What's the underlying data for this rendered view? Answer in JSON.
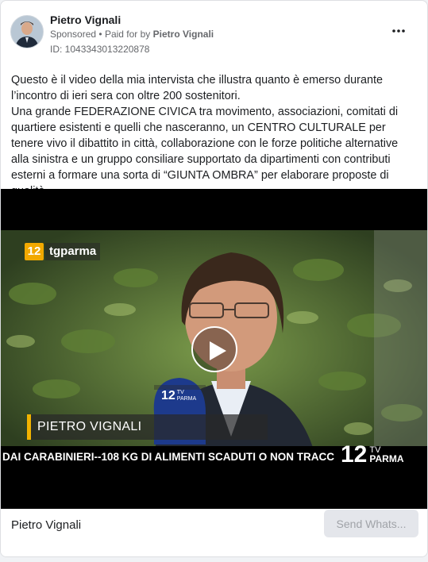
{
  "post": {
    "page_name": "Pietro Vignali",
    "sponsored_label": "Sponsored",
    "separator": "•",
    "paid_for_by_label": "Paid for by",
    "paid_for_by_name": "Pietro Vignali",
    "ad_id": "ID: 1043343013220878",
    "more_icon": "more-horizontal-icon",
    "body": [
      "Questo è il video della mia intervista che illustra quanto è emerso durante l’incontro di ieri sera con oltre 200 sostenitori.",
      "Una grande FEDERAZIONE CIVICA tra movimento, associazioni, comitati di quartiere esistenti e quelli che nasceranno, un CENTRO CULTURALE per tenere vivo il dibattito in città, collaborazione con le forze politiche alternative alla sinistra e un gruppo consiliare supportato da dipartimenti con contributi esterni a formare una sorta di “GIUNTA OMBRA” per elaborare proposte di qualità…."
    ]
  },
  "video": {
    "logo_number": "12",
    "logo_brand": "tgparma",
    "lower_third_name": "PIETRO VIGNALI",
    "ticker_text": "DAI CARABINIERI--108 KG DI ALIMENTI SCADUTI O NON TRACC",
    "ticker_logo_number": "12",
    "ticker_logo_tv": "TV",
    "ticker_logo_city": "PARMA",
    "mic_label_number": "12",
    "mic_label_tv": "TV",
    "mic_label_city": "PARMA",
    "play_icon": "play-icon"
  },
  "footer": {
    "advertiser_name": "Pietro Vignali",
    "cta_label": "Send Whats..."
  },
  "colors": {
    "accent_yellow": "#f2b300",
    "cta_bg": "#e4e6eb",
    "cta_text": "#a0a3a8",
    "meta_text": "#65676b"
  }
}
